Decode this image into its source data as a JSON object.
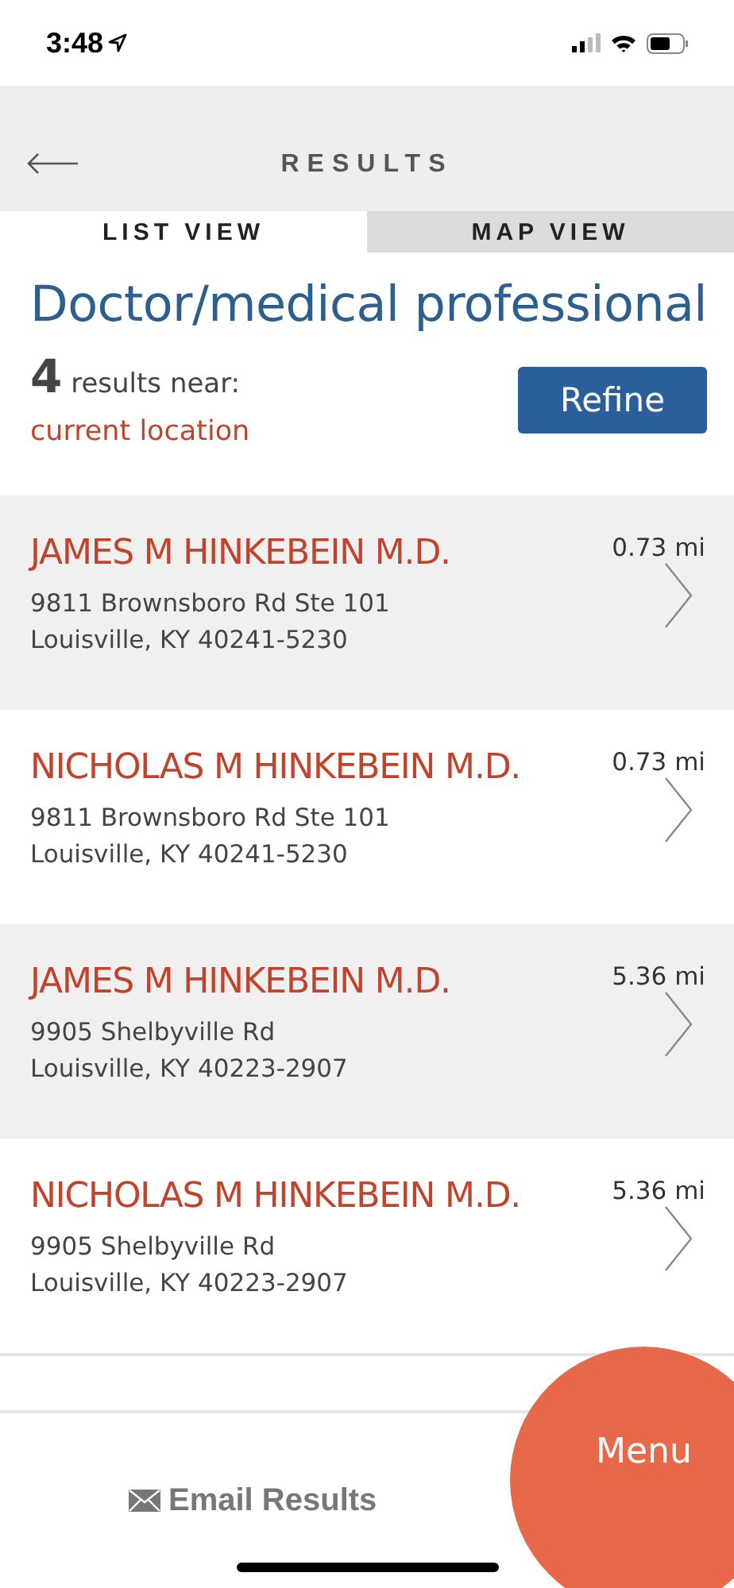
{
  "status_bar": {
    "time": "3:48"
  },
  "header": {
    "title": "RESULTS"
  },
  "tabs": [
    {
      "label": "LIST VIEW",
      "selected": true
    },
    {
      "label": "MAP VIEW",
      "selected": false
    }
  ],
  "category": "Doctor/medical professional",
  "summary": {
    "count": "4",
    "text": "results near:",
    "location": "current location"
  },
  "refine_button": "Refine",
  "results": [
    {
      "name": "JAMES M HINKEBEIN M.D.",
      "address_line_1": "9811 Brownsboro Rd Ste 101",
      "address_line_2": "Louisville, KY 40241-5230",
      "distance": "0.73 mi"
    },
    {
      "name": "NICHOLAS M HINKEBEIN M.D.",
      "address_line_1": "9811 Brownsboro Rd Ste 101",
      "address_line_2": "Louisville, KY 40241-5230",
      "distance": "0.73 mi"
    },
    {
      "name": "JAMES M HINKEBEIN M.D.",
      "address_line_1": "9905 Shelbyville Rd",
      "address_line_2": "Louisville, KY 40223-2907",
      "distance": "5.36 mi"
    },
    {
      "name": "NICHOLAS M HINKEBEIN M.D.",
      "address_line_1": "9905 Shelbyville Rd",
      "address_line_2": "Louisville, KY 40223-2907",
      "distance": "5.36 mi"
    }
  ],
  "footer": {
    "email_button": "Email Results",
    "menu_button": "Menu"
  }
}
